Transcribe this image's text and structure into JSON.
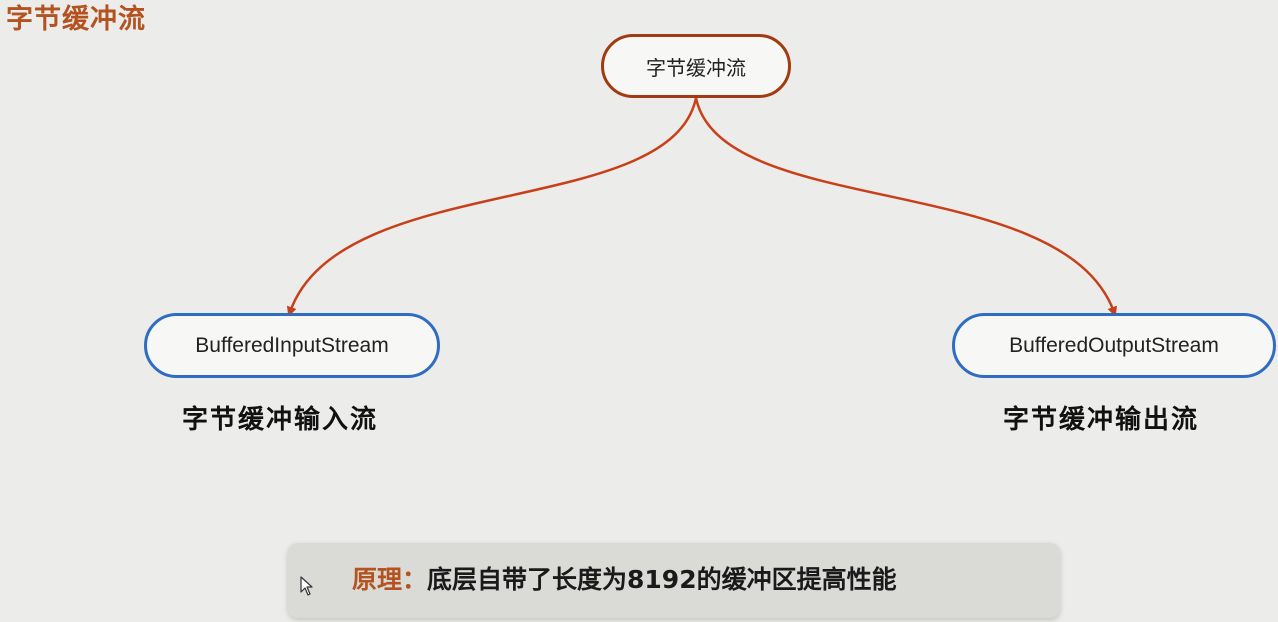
{
  "slide": {
    "title": "字节缓冲流"
  },
  "diagram": {
    "root": {
      "label": "字节缓冲流"
    },
    "children": [
      {
        "label": "BufferedInputStream",
        "caption": "字节缓冲输入流"
      },
      {
        "label": "BufferedOutputStream",
        "caption": "字节缓冲输出流"
      }
    ],
    "colors": {
      "root_border": "#a23a12",
      "child_border": "#2f6cc4",
      "connector": "#c8401a",
      "title": "#b4531f"
    }
  },
  "note": {
    "label": "原理：",
    "text": "底层自带了长度为8192的缓冲区提高性能"
  },
  "icons": {
    "cursor": "mouse-pointer-icon"
  }
}
